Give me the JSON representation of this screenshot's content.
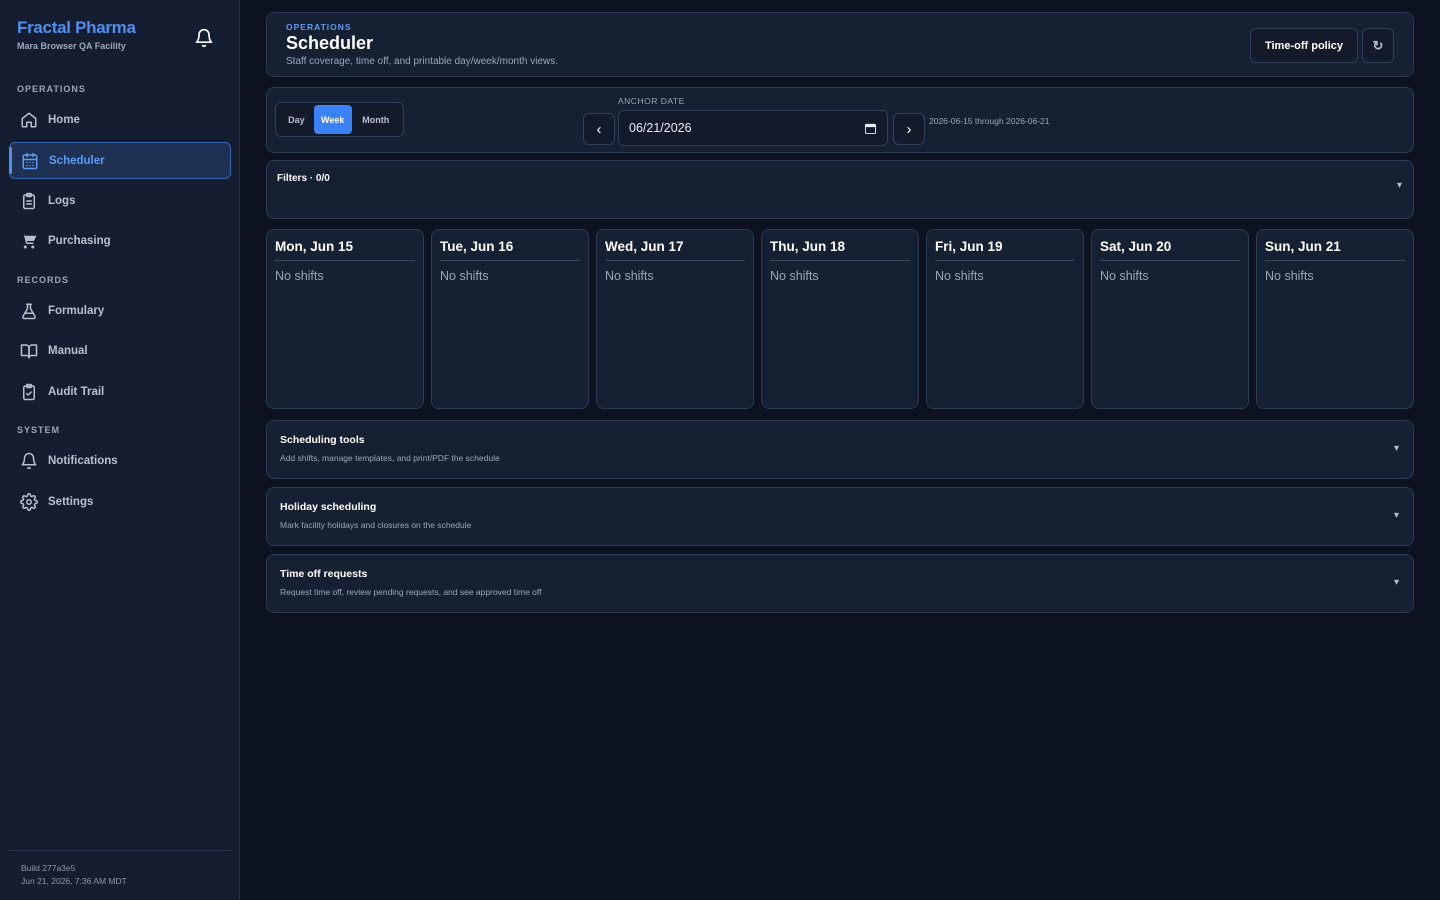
{
  "brand": {
    "name": "Fractal Pharma",
    "subtitle": "Mara Browser QA Facility"
  },
  "sidebar": {
    "sections": [
      {
        "label": "OPERATIONS"
      },
      {
        "label": "RECORDS"
      },
      {
        "label": "SYSTEM"
      }
    ],
    "items": [
      {
        "label": "Home",
        "icon": "home-icon"
      },
      {
        "label": "Scheduler",
        "icon": "calendar-icon",
        "active": true
      },
      {
        "label": "Logs",
        "icon": "clipboard-icon"
      },
      {
        "label": "Purchasing",
        "icon": "cart-icon"
      },
      {
        "label": "Formulary",
        "icon": "flask-icon"
      },
      {
        "label": "Manual",
        "icon": "book-icon"
      },
      {
        "label": "Audit Trail",
        "icon": "clipboard-check-icon"
      },
      {
        "label": "Notifications",
        "icon": "bell-icon"
      },
      {
        "label": "Settings",
        "icon": "gear-icon"
      }
    ],
    "footer": {
      "build": "Build 277a3e5",
      "timestamp": "Jun 21, 2026, 7:36 AM MDT"
    }
  },
  "header": {
    "eyebrow": "OPERATIONS",
    "title": "Scheduler",
    "description": "Staff coverage, time off, and printable day/week/month views.",
    "policy_button": "Time-off policy",
    "refresh_glyph": "↻"
  },
  "toolbar": {
    "views": [
      "Day",
      "Week",
      "Month"
    ],
    "active_view": "Week",
    "anchor_label": "ANCHOR DATE",
    "anchor_value": "06/21/2026",
    "prev_glyph": "‹",
    "next_glyph": "›",
    "range_text": "2026-06-15 through 2026-06-21"
  },
  "filters": {
    "label": "Filters · 0/0"
  },
  "week": {
    "days": [
      {
        "title": "Mon, Jun 15",
        "empty": "No shifts"
      },
      {
        "title": "Tue, Jun 16",
        "empty": "No shifts"
      },
      {
        "title": "Wed, Jun 17",
        "empty": "No shifts"
      },
      {
        "title": "Thu, Jun 18",
        "empty": "No shifts"
      },
      {
        "title": "Fri, Jun 19",
        "empty": "No shifts"
      },
      {
        "title": "Sat, Jun 20",
        "empty": "No shifts"
      },
      {
        "title": "Sun, Jun 21",
        "empty": "No shifts"
      }
    ]
  },
  "accordions": [
    {
      "title": "Scheduling tools",
      "description": "Add shifts, manage templates, and print/PDF the schedule"
    },
    {
      "title": "Holiday scheduling",
      "description": "Mark facility holidays and closures on the schedule"
    },
    {
      "title": "Time off requests",
      "description": "Request time off, review pending requests, and see approved time off"
    }
  ],
  "chevron_glyph": "▾",
  "colors": {
    "accent": "#3b82f6",
    "brand": "#4f8ff0",
    "background": "#0c1220",
    "surface": "#162033"
  }
}
